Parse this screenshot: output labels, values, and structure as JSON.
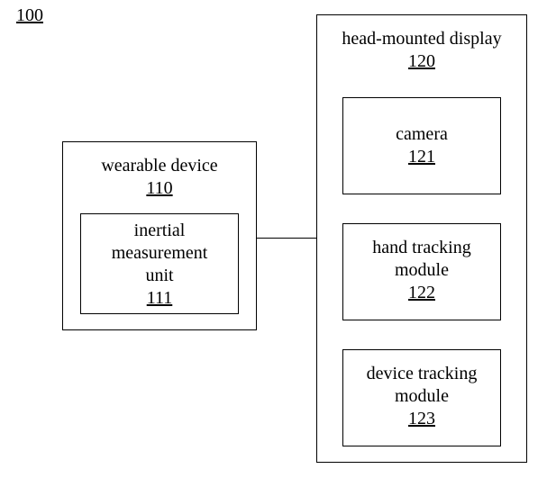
{
  "figure_ref": "100",
  "wearable": {
    "label": "wearable device",
    "ref": "110",
    "imu": {
      "line1": "inertial",
      "line2": "measurement",
      "line3": "unit",
      "ref": "111"
    }
  },
  "hmd": {
    "label": "head-mounted display",
    "ref": "120",
    "camera": {
      "label": "camera",
      "ref": "121"
    },
    "hand_tracking": {
      "line1": "hand  tracking",
      "line2": "module",
      "ref": "122"
    },
    "device_tracking": {
      "line1": "device tracking",
      "line2": "module",
      "ref": "123"
    }
  }
}
